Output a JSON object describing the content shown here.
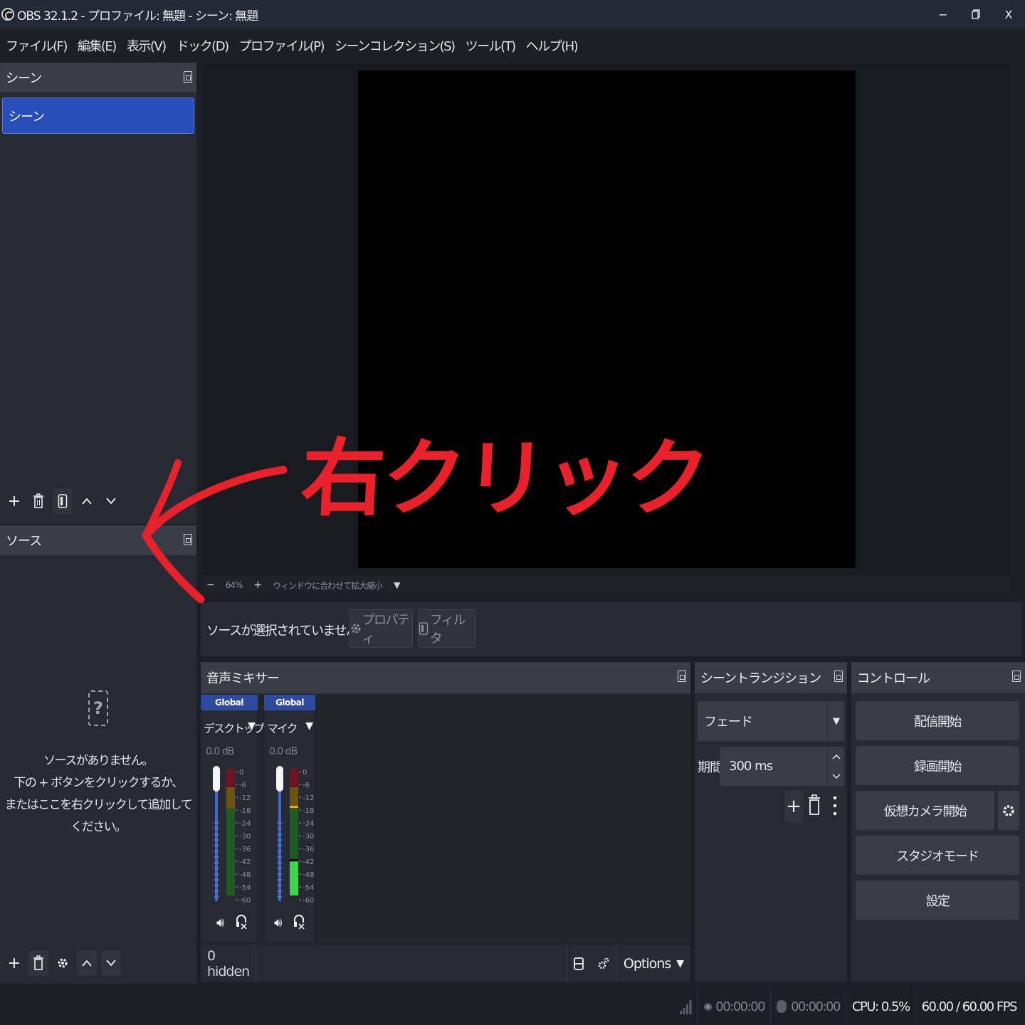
{
  "titlebar": {
    "title": "OBS 32.1.2 - プロファイル: 無題 - シーン: 無題",
    "minimize": "−",
    "restore": "▢",
    "close": "X"
  },
  "menu": [
    "ファイル(F)",
    "編集(E)",
    "表示(V)",
    "ドック(D)",
    "プロファイル(P)",
    "シーンコレクション(S)",
    "ツール(T)",
    "ヘルプ(H)"
  ],
  "scenes": {
    "title": "シーン",
    "items": [
      "シーン"
    ]
  },
  "sources": {
    "title": "ソース",
    "empty_line1": "ソースがありません。",
    "empty_line2": "下の + ボタンをクリックするか、",
    "empty_line3": "またはここを右クリックして追加してください。"
  },
  "preview": {
    "zoom_minus": "−",
    "zoom_level": "64%",
    "zoom_plus": "+",
    "fit_label": "ウィンドウに合わせて拡大縮小",
    "dropdown": "▼"
  },
  "context": {
    "no_source": "ソースが選択されていません",
    "properties": "プロパティ",
    "filters": "フィルタ"
  },
  "mixer": {
    "title": "音声ミキサー",
    "channels": [
      {
        "tag": "Global",
        "name": "デスクトップ音声",
        "db": "0.0 dB",
        "level": 0.0
      },
      {
        "tag": "Global",
        "name": "マイク",
        "db": "0.0 dB",
        "level": 0.4
      }
    ],
    "scale": [
      "0",
      "-6",
      "-12",
      "-18",
      "-24",
      "-30",
      "-36",
      "-42",
      "-48",
      "-54",
      "-60"
    ],
    "hidden": "0 hidden",
    "options": "Options"
  },
  "transitions": {
    "title": "シーントランジション",
    "selected": "フェード",
    "duration_label": "期間",
    "duration_value": "300 ms"
  },
  "controls": {
    "title": "コントロール",
    "start_streaming": "配信開始",
    "start_recording": "録画開始",
    "start_virtualcam": "仮想カメラ開始",
    "studio_mode": "スタジオモード",
    "settings": "設定"
  },
  "status": {
    "stream_time": "00:00:00",
    "record_time": "00:00:00",
    "cpu": "CPU: 0.5%",
    "fps": "60.00 / 60.00 FPS"
  },
  "annotation": {
    "text": "右クリック",
    "color": "#e8212a"
  },
  "colors": {
    "accent": "#284cb8",
    "panel": "#272a33",
    "header": "#3a3d46"
  }
}
